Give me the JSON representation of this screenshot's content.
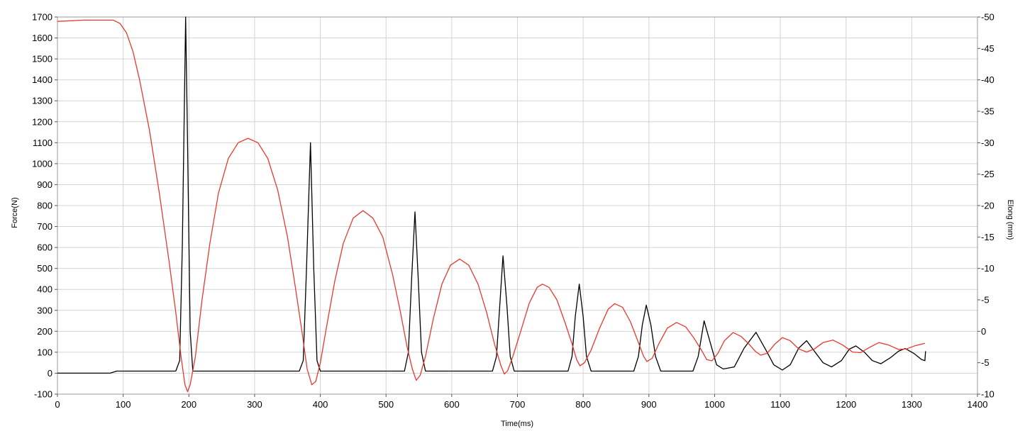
{
  "chart_data": {
    "type": "line",
    "title": "",
    "xlabel": "Time(ms)",
    "ylabel": "Force(N)",
    "y2label": "Elong (mm)",
    "xlim": [
      0,
      1400
    ],
    "ylim": [
      -100,
      1700
    ],
    "y2lim": [
      -10,
      50
    ],
    "x_ticks": [
      0,
      100,
      200,
      300,
      400,
      500,
      600,
      700,
      800,
      900,
      1000,
      1100,
      1200,
      1300,
      1400
    ],
    "y_ticks": [
      -100,
      0,
      100,
      200,
      300,
      400,
      500,
      600,
      700,
      800,
      900,
      1000,
      1100,
      1200,
      1300,
      1400,
      1500,
      1600,
      1700
    ],
    "y2_ticks": [
      -10,
      -5,
      0,
      5,
      10,
      15,
      20,
      25,
      30,
      35,
      40,
      45,
      50
    ],
    "grid": true,
    "legend": "none",
    "series": [
      {
        "axis": "left",
        "color": "#000000",
        "points": [
          [
            0,
            0
          ],
          [
            80,
            0
          ],
          [
            85,
            5
          ],
          [
            90,
            10
          ],
          [
            180,
            10
          ],
          [
            186,
            60
          ],
          [
            190,
            600
          ],
          [
            195,
            1700
          ],
          [
            198,
            1100
          ],
          [
            202,
            200
          ],
          [
            206,
            10
          ],
          [
            368,
            10
          ],
          [
            374,
            60
          ],
          [
            379,
            500
          ],
          [
            385,
            1100
          ],
          [
            390,
            500
          ],
          [
            395,
            60
          ],
          [
            400,
            10
          ],
          [
            528,
            10
          ],
          [
            534,
            100
          ],
          [
            539,
            450
          ],
          [
            544,
            770
          ],
          [
            549,
            450
          ],
          [
            554,
            100
          ],
          [
            560,
            10
          ],
          [
            662,
            10
          ],
          [
            668,
            80
          ],
          [
            673,
            320
          ],
          [
            678,
            560
          ],
          [
            684,
            320
          ],
          [
            689,
            80
          ],
          [
            695,
            10
          ],
          [
            777,
            10
          ],
          [
            783,
            80
          ],
          [
            788,
            270
          ],
          [
            794,
            425
          ],
          [
            800,
            270
          ],
          [
            805,
            80
          ],
          [
            812,
            10
          ],
          [
            877,
            10
          ],
          [
            884,
            80
          ],
          [
            890,
            230
          ],
          [
            896,
            325
          ],
          [
            903,
            230
          ],
          [
            910,
            80
          ],
          [
            918,
            10
          ],
          [
            967,
            10
          ],
          [
            975,
            80
          ],
          [
            984,
            250
          ],
          [
            993,
            150
          ],
          [
            1003,
            40
          ],
          [
            1013,
            20
          ],
          [
            1030,
            30
          ],
          [
            1045,
            120
          ],
          [
            1063,
            195
          ],
          [
            1080,
            100
          ],
          [
            1090,
            40
          ],
          [
            1103,
            15
          ],
          [
            1115,
            40
          ],
          [
            1128,
            120
          ],
          [
            1140,
            155
          ],
          [
            1153,
            100
          ],
          [
            1165,
            50
          ],
          [
            1178,
            30
          ],
          [
            1193,
            60
          ],
          [
            1205,
            115
          ],
          [
            1215,
            130
          ],
          [
            1228,
            100
          ],
          [
            1240,
            60
          ],
          [
            1253,
            45
          ],
          [
            1268,
            75
          ],
          [
            1280,
            105
          ],
          [
            1290,
            118
          ],
          [
            1303,
            95
          ],
          [
            1315,
            65
          ],
          [
            1320,
            60
          ],
          [
            1321,
            105
          ]
        ]
      },
      {
        "axis": "right",
        "color": "#e8382f",
        "points": [
          [
            0,
            49.3
          ],
          [
            40,
            49.5
          ],
          [
            85,
            49.5
          ],
          [
            95,
            49.0
          ],
          [
            105,
            47.5
          ],
          [
            115,
            44.5
          ],
          [
            125,
            40.0
          ],
          [
            140,
            32.0
          ],
          [
            155,
            22.0
          ],
          [
            170,
            11.0
          ],
          [
            180,
            3.0
          ],
          [
            188,
            -4.0
          ],
          [
            194,
            -8.5
          ],
          [
            198,
            -9.6
          ],
          [
            202,
            -8.5
          ],
          [
            210,
            -4.0
          ],
          [
            220,
            5.0
          ],
          [
            232,
            14.0
          ],
          [
            245,
            22.0
          ],
          [
            260,
            27.5
          ],
          [
            275,
            30.0
          ],
          [
            290,
            30.7
          ],
          [
            305,
            30.0
          ],
          [
            320,
            27.5
          ],
          [
            335,
            22.5
          ],
          [
            350,
            15.0
          ],
          [
            362,
            7.0
          ],
          [
            372,
            0.0
          ],
          [
            380,
            -6.0
          ],
          [
            387,
            -8.5
          ],
          [
            393,
            -8.0
          ],
          [
            400,
            -5.0
          ],
          [
            410,
            1.0
          ],
          [
            422,
            8.0
          ],
          [
            435,
            14.0
          ],
          [
            450,
            18.0
          ],
          [
            465,
            19.2
          ],
          [
            480,
            18.0
          ],
          [
            495,
            15.0
          ],
          [
            510,
            9.0
          ],
          [
            522,
            3.0
          ],
          [
            532,
            -2.5
          ],
          [
            540,
            -6.0
          ],
          [
            546,
            -7.8
          ],
          [
            552,
            -7.0
          ],
          [
            560,
            -4.0
          ],
          [
            572,
            2.0
          ],
          [
            585,
            7.5
          ],
          [
            598,
            10.5
          ],
          [
            612,
            11.5
          ],
          [
            626,
            10.5
          ],
          [
            640,
            7.5
          ],
          [
            653,
            3.0
          ],
          [
            665,
            -2.0
          ],
          [
            675,
            -5.5
          ],
          [
            680,
            -6.8
          ],
          [
            685,
            -6.3
          ],
          [
            693,
            -4.0
          ],
          [
            705,
            0.0
          ],
          [
            718,
            4.5
          ],
          [
            730,
            7.0
          ],
          [
            738,
            7.5
          ],
          [
            748,
            7.0
          ],
          [
            760,
            5.0
          ],
          [
            772,
            1.5
          ],
          [
            783,
            -2.0
          ],
          [
            790,
            -4.5
          ],
          [
            795,
            -5.5
          ],
          [
            802,
            -5.0
          ],
          [
            812,
            -3.0
          ],
          [
            825,
            0.5
          ],
          [
            838,
            3.5
          ],
          [
            848,
            4.4
          ],
          [
            860,
            3.8
          ],
          [
            872,
            1.5
          ],
          [
            883,
            -1.5
          ],
          [
            892,
            -4.0
          ],
          [
            897,
            -4.8
          ],
          [
            905,
            -4.3
          ],
          [
            915,
            -2.0
          ],
          [
            928,
            0.5
          ],
          [
            942,
            1.4
          ],
          [
            956,
            0.7
          ],
          [
            968,
            -1.0
          ],
          [
            980,
            -3.0
          ],
          [
            988,
            -4.5
          ],
          [
            996,
            -4.7
          ],
          [
            1005,
            -3.5
          ],
          [
            1015,
            -1.5
          ],
          [
            1028,
            -0.2
          ],
          [
            1040,
            -0.8
          ],
          [
            1052,
            -2.0
          ],
          [
            1062,
            -3.2
          ],
          [
            1070,
            -3.8
          ],
          [
            1080,
            -3.5
          ],
          [
            1092,
            -2.0
          ],
          [
            1103,
            -1.0
          ],
          [
            1115,
            -1.5
          ],
          [
            1128,
            -2.8
          ],
          [
            1140,
            -3.3
          ],
          [
            1152,
            -2.8
          ],
          [
            1165,
            -1.8
          ],
          [
            1180,
            -1.4
          ],
          [
            1195,
            -2.2
          ],
          [
            1210,
            -3.3
          ],
          [
            1222,
            -3.4
          ],
          [
            1235,
            -2.6
          ],
          [
            1250,
            -1.8
          ],
          [
            1265,
            -2.2
          ],
          [
            1280,
            -2.9
          ],
          [
            1292,
            -2.8
          ],
          [
            1305,
            -2.3
          ],
          [
            1320,
            -1.9
          ]
        ]
      }
    ]
  }
}
